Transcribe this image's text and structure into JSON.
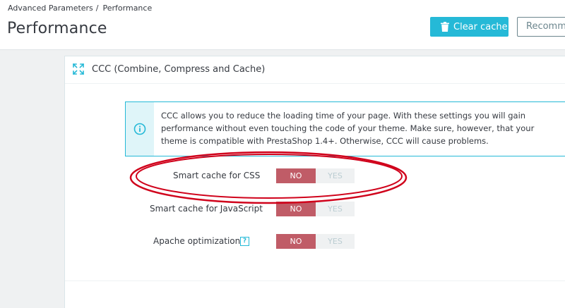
{
  "breadcrumb": {
    "parent": "Advanced Parameters",
    "separator": "/",
    "current": "Performance"
  },
  "page_title": "Performance",
  "toolbar": {
    "clear_cache_label": "Clear cache",
    "recommended_label": "Recommended modules"
  },
  "panel": {
    "title": "CCC (Combine, Compress and Cache)",
    "info_text": "CCC allows you to reduce the loading time of your page. With these settings you will gain performance without even touching the code of your theme. Make sure, however, that your theme is compatible with PrestaShop 1.4+. Otherwise, CCC will cause problems.",
    "settings": [
      {
        "label": "Smart cache for CSS",
        "no": "NO",
        "yes": "YES",
        "value": "NO"
      },
      {
        "label": "Smart cache for JavaScript",
        "no": "NO",
        "yes": "YES",
        "value": "NO"
      },
      {
        "label": "Apache optimization",
        "no": "NO",
        "yes": "YES",
        "value": "NO",
        "help": "?"
      }
    ]
  },
  "colors": {
    "accent": "#25b9d7",
    "switch_off": "#c05c67",
    "annotation_ellipse": "#d0021b"
  },
  "icons": [
    "trash-icon",
    "expand-icon",
    "info-icon",
    "help-icon"
  ]
}
